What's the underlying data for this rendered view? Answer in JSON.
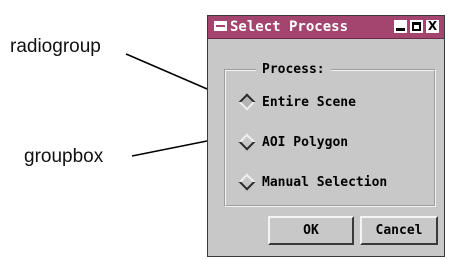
{
  "callouts": {
    "radiogroup": "radiogroup",
    "groupbox": "groupbox"
  },
  "window": {
    "title": "Select Process",
    "controls": {
      "close_glyph": "X"
    },
    "accent_color": "#a3456e",
    "background_color": "#c8c8c8"
  },
  "process_group": {
    "label": "Process:",
    "options": [
      {
        "label": "Entire Scene",
        "selected": true
      },
      {
        "label": "AOI Polygon",
        "selected": false
      },
      {
        "label": "Manual Selection",
        "selected": false
      }
    ]
  },
  "buttons": {
    "ok_label": "OK",
    "cancel_label": "Cancel"
  }
}
